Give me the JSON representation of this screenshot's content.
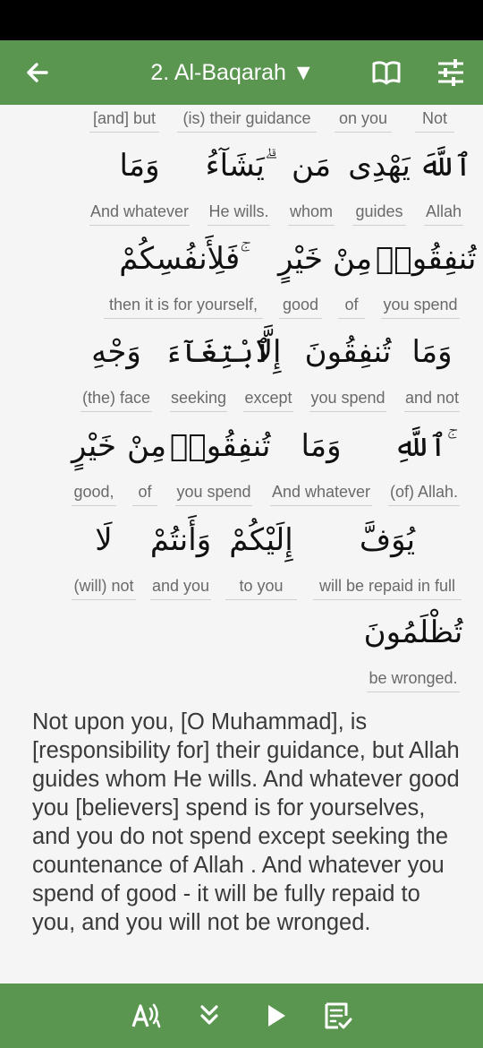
{
  "app_bar": {
    "title": "2. Al-Baqarah ▼",
    "back_icon": "arrow-left-icon",
    "book_icon": "open-book-icon",
    "settings_icon": "tune-sliders-icon",
    "color": "#5a9650"
  },
  "rows": [
    {
      "words": [
        {
          "en": "Not"
        },
        {
          "en": "on you"
        },
        {
          "en": "(is) their guidance"
        },
        {
          "en": "[and] but"
        }
      ]
    },
    {
      "words": [
        {
          "ar": "ٱللَّهَ",
          "en": "Allah"
        },
        {
          "ar": "يَهْدِى",
          "en": "guides"
        },
        {
          "ar": "مَن",
          "en": "whom"
        },
        {
          "ar": "يَشَآءُ ۗ",
          "en": "He wills."
        },
        {
          "ar": "وَمَا",
          "en": "And whatever"
        }
      ]
    },
    {
      "words": [
        {
          "ar": "تُنفِقُوا۟",
          "en": "you spend"
        },
        {
          "ar": "مِنْ",
          "en": "of"
        },
        {
          "ar": "خَيْرٍ",
          "en": "good"
        },
        {
          "ar": "فَلِأَنفُسِكُمْ ۚ",
          "en": "then it is for yourself,"
        }
      ]
    },
    {
      "words": [
        {
          "ar": "وَمَا",
          "en": "and not"
        },
        {
          "ar": "تُنفِقُونَ",
          "en": "you spend"
        },
        {
          "ar": "إِلَّا",
          "en": "except"
        },
        {
          "ar": "ٱبْتِغَآءَ",
          "en": "seeking"
        },
        {
          "ar": "وَجْهِ",
          "en": "(the) face"
        }
      ]
    },
    {
      "words": [
        {
          "ar": "ٱللَّهِ ۚ",
          "en": "(of) Allah."
        },
        {
          "ar": "وَمَا",
          "en": "And whatever"
        },
        {
          "ar": "تُنفِقُوا۟",
          "en": "you spend"
        },
        {
          "ar": "مِنْ",
          "en": "of"
        },
        {
          "ar": "خَيْرٍ",
          "en": "good,"
        }
      ]
    },
    {
      "words": [
        {
          "ar": "يُوَفَّ",
          "en": "will be repaid in full"
        },
        {
          "ar": "إِلَيْكُمْ",
          "en": "to you"
        },
        {
          "ar": "وَأَنتُمْ",
          "en": "and you"
        },
        {
          "ar": "لَا",
          "en": "(will) not"
        }
      ]
    },
    {
      "words": [
        {
          "ar": "تُظْلَمُونَ",
          "en": "be wronged."
        }
      ]
    }
  ],
  "translation": "Not upon you, [O Muhammad], is [responsibility for] their guidance, but Allah guides whom He wills. And whatever good you [believers] spend is for yourselves, and you do not spend except seeking the countenance of Allah . And whatever you spend of good - it will be fully repaid to you, and you will not be wronged.",
  "bottom_bar": {
    "icons": [
      "translate-icon",
      "double-chevron-down-icon",
      "play-icon",
      "notes-icon"
    ]
  }
}
